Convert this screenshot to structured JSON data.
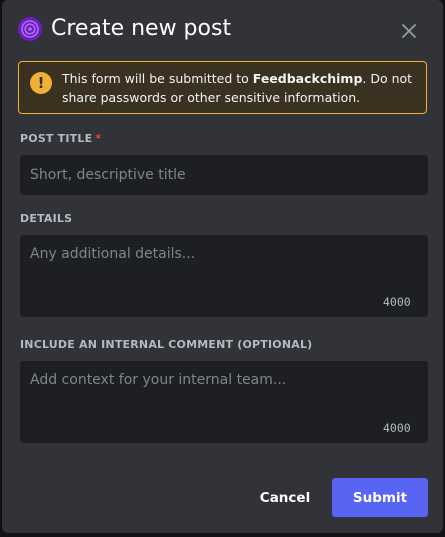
{
  "dialog": {
    "title": "Create new post",
    "logo_icon": "feedbackchimp-logo-icon",
    "close_icon": "close-icon"
  },
  "alert": {
    "icon": "warning-icon",
    "text_before": "This form will be submitted to ",
    "app_name": "Feedbackchimp",
    "text_after": ". Do not share passwords or other sensitive information.",
    "color": "#f0b232"
  },
  "fields": {
    "post_title": {
      "label": "POST TITLE",
      "required_mark": "*",
      "placeholder": "Short, descriptive title",
      "value": ""
    },
    "details": {
      "label": "DETAILS",
      "placeholder": "Any additional details...",
      "value": "",
      "counter": "4000"
    },
    "internal_comment": {
      "label": "INCLUDE AN INTERNAL COMMENT (OPTIONAL)",
      "placeholder": "Add context for your internal team...",
      "value": "",
      "counter": "4000"
    }
  },
  "actions": {
    "cancel_label": "Cancel",
    "submit_label": "Submit",
    "submit_color": "#5865f2"
  }
}
